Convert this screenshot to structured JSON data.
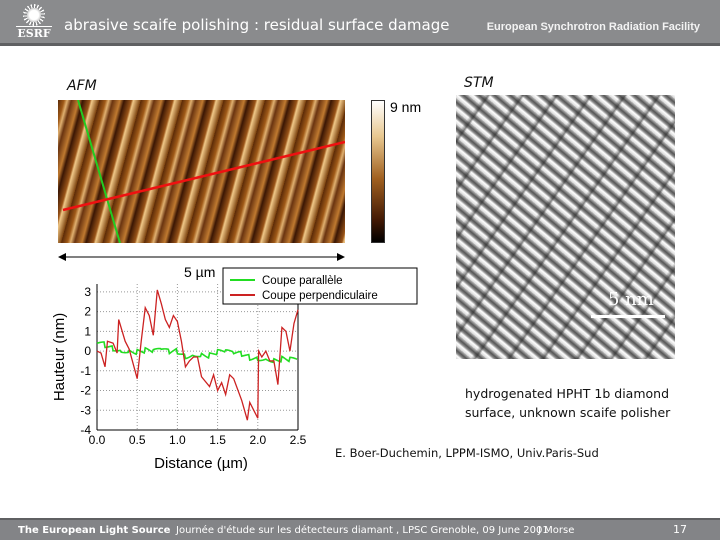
{
  "header": {
    "title": "abrasive scaife polishing : residual surface damage",
    "org": "European Synchrotron Radiation Facility",
    "logo_text": "ESRF"
  },
  "afm": {
    "label": "AFM",
    "colorbar_max": "9 nm",
    "scale": "5 µm"
  },
  "stm": {
    "label": "STM",
    "scale": "5 nm",
    "caption_line1": "hydrogenated HPHT 1b diamond",
    "caption_line2": "surface, unknown scaife polisher"
  },
  "credit": "E. Boer-Duchemin, LPPM-ISMO, Univ.Paris-Sud",
  "footer": {
    "left": "The European Light Source",
    "center": "Journée d'étude sur les détecteurs diamant , LPSC Grenoble,  09 June 2001",
    "author": "J Morse",
    "page": "17"
  },
  "chart_data": {
    "type": "line",
    "xlabel": "Distance (µm)",
    "ylabel": "Hauteur (nm)",
    "xlim": [
      0,
      2.5
    ],
    "ylim": [
      -4,
      3.4
    ],
    "xticks": [
      "0.0",
      "0.5",
      "1.0",
      "1.5",
      "2.0",
      "2.5"
    ],
    "yticks": [
      "3",
      "2",
      "1",
      "0",
      "-1",
      "-2",
      "-3",
      "-4"
    ],
    "grid": true,
    "legend": "top-right",
    "series": [
      {
        "name": "Coupe parallèle",
        "color": "#22dd22",
        "x": [
          0,
          0.1,
          0.2,
          0.3,
          0.4,
          0.5,
          0.6,
          0.7,
          0.8,
          0.9,
          1.0,
          1.1,
          1.2,
          1.3,
          1.4,
          1.5,
          1.6,
          1.7,
          1.8,
          1.9,
          2.0,
          2.1,
          2.2,
          2.3,
          2.4,
          2.5
        ],
        "y": [
          0.4,
          0.3,
          0.2,
          0.1,
          0.1,
          0.0,
          0.0,
          -0.1,
          0.0,
          -0.1,
          0.0,
          -0.2,
          -0.1,
          -0.1,
          -0.2,
          -0.1,
          -0.1,
          -0.2,
          -0.2,
          -0.3,
          -0.3,
          -0.3,
          -0.4,
          -0.4,
          -0.5,
          -0.5
        ]
      },
      {
        "name": "Coupe perpendiculaire",
        "color": "#cc2222",
        "x": [
          0,
          0.05,
          0.1,
          0.13,
          0.2,
          0.25,
          0.27,
          0.35,
          0.4,
          0.5,
          0.55,
          0.6,
          0.65,
          0.7,
          0.75,
          0.8,
          0.85,
          0.9,
          0.95,
          1.0,
          1.05,
          1.1,
          1.15,
          1.2,
          1.25,
          1.3,
          1.4,
          1.45,
          1.5,
          1.55,
          1.6,
          1.65,
          1.7,
          1.8,
          1.87,
          1.9,
          1.95,
          2.0,
          2.01,
          2.05,
          2.1,
          2.15,
          2.2,
          2.25,
          2.3,
          2.35,
          2.4,
          2.45,
          2.5
        ],
        "y": [
          0,
          -0.1,
          -0.8,
          0.5,
          0.4,
          -0.1,
          1.6,
          0.5,
          0.1,
          -1.4,
          0.5,
          2.2,
          1.8,
          0.8,
          3.1,
          2.4,
          1.6,
          1.2,
          1.8,
          1.5,
          0.5,
          -0.8,
          -0.5,
          -0.3,
          -0.3,
          -1.3,
          -1.8,
          -1.2,
          -2.0,
          -1.6,
          -2.2,
          -1.2,
          -1.4,
          -2.5,
          -3.5,
          -2.6,
          -3.0,
          -3.4,
          0,
          -0.3,
          0,
          -0.5,
          -0.5,
          -1.7,
          1.2,
          1.0,
          0,
          1.4,
          2.1
        ]
      }
    ]
  }
}
